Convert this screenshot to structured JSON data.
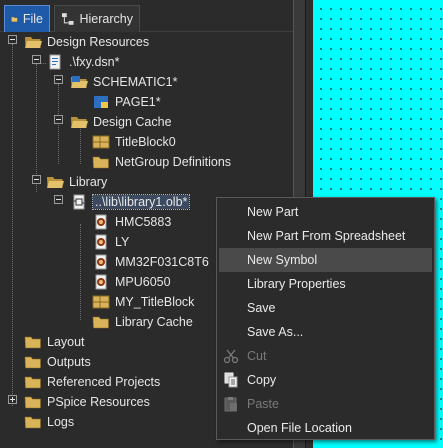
{
  "tabs": {
    "file": "File",
    "hierarchy": "Hierarchy"
  },
  "tree": {
    "design_resources": "Design Resources",
    "dsn": ".\\fxy.dsn*",
    "schematic": "SCHEMATIC1*",
    "page": "PAGE1*",
    "design_cache": "Design Cache",
    "titleblock0": "TitleBlock0",
    "netgroup": "NetGroup Definitions",
    "library": "Library",
    "olb": "..\\lib\\library1.olb*",
    "hmc5883": "HMC5883",
    "ly": "LY",
    "mm32": "MM32F031C8T6",
    "mpu6050": "MPU6050",
    "my_titleblock": "MY_TitleBlock",
    "library_cache": "Library Cache",
    "layout": "Layout",
    "outputs": "Outputs",
    "referenced_projects": "Referenced Projects",
    "pspice_resources": "PSpice Resources",
    "logs": "Logs"
  },
  "context_menu": {
    "new_part": "New Part",
    "new_part_spreadsheet": "New Part From Spreadsheet",
    "new_symbol": "New Symbol",
    "library_properties": "Library Properties",
    "save": "Save",
    "save_as": "Save As...",
    "cut": "Cut",
    "copy": "Copy",
    "paste": "Paste",
    "open_file_location": "Open File Location"
  },
  "colors": {
    "background": "#2b2b2b",
    "active_tab": "#1e5aa8",
    "canvas": "#00ffff",
    "folder": "#d8b35a",
    "menu_hover": "#4a4a4a"
  }
}
